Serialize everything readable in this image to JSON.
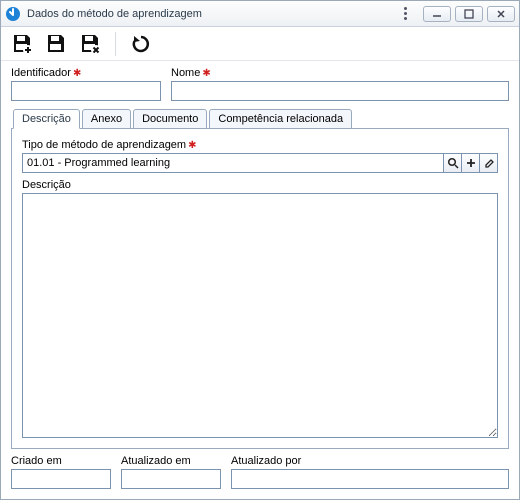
{
  "window": {
    "title": "Dados do método de aprendizagem"
  },
  "toolbar": {
    "icons": {
      "save_new": "floppy-plus",
      "save": "floppy",
      "save_delete": "floppy-x",
      "refresh": "refresh"
    }
  },
  "fields": {
    "identifier": {
      "label": "Identificador",
      "value": "",
      "required": true
    },
    "name": {
      "label": "Nome",
      "value": "",
      "required": true
    }
  },
  "tabs": [
    {
      "id": "descricao",
      "label": "Descrição",
      "active": true
    },
    {
      "id": "anexo",
      "label": "Anexo",
      "active": false
    },
    {
      "id": "documento",
      "label": "Documento",
      "active": false
    },
    {
      "id": "competencia",
      "label": "Competência relacionada",
      "active": false
    }
  ],
  "descricao": {
    "method_type": {
      "label": "Tipo de método de aprendizagem",
      "value": "01.01 - Programmed learning",
      "required": true
    },
    "description": {
      "label": "Descrição",
      "value": ""
    }
  },
  "audit": {
    "created_at": {
      "label": "Criado em",
      "value": ""
    },
    "updated_at": {
      "label": "Atualizado em",
      "value": ""
    },
    "updated_by": {
      "label": "Atualizado por",
      "value": ""
    }
  }
}
